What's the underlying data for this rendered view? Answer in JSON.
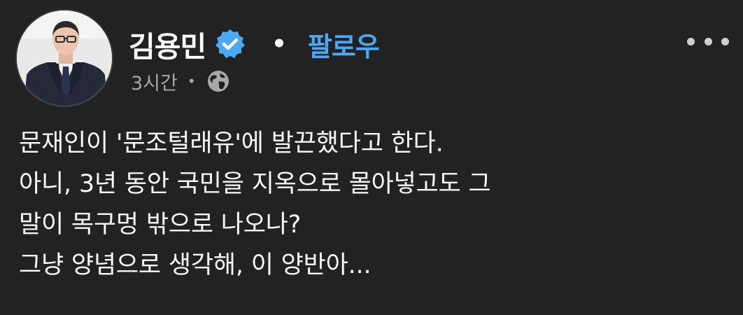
{
  "post": {
    "author": {
      "name": "김용민",
      "verified": true,
      "verified_icon": "verified-badge-icon"
    },
    "separator": "•",
    "follow_label": "팔로우",
    "timestamp": "3시간",
    "meta_separator": "•",
    "audience_icon": "globe-icon",
    "more_icon": "more-options-icon",
    "body_lines": [
      "문재인이 '문조털래유'에 발끈했다고 한다.",
      "아니, 3년 동안 국민을 지옥으로 몰아넣고도 그",
      "말이 목구멍 밖으로 나오나?",
      "그냥 양념으로 생각해, 이 양반아..."
    ]
  },
  "colors": {
    "background": "#222223",
    "text": "#f7f7f7",
    "muted": "#a8a8a8",
    "follow_accent": "#4aa8f5",
    "badge": "#4aa8f5"
  }
}
